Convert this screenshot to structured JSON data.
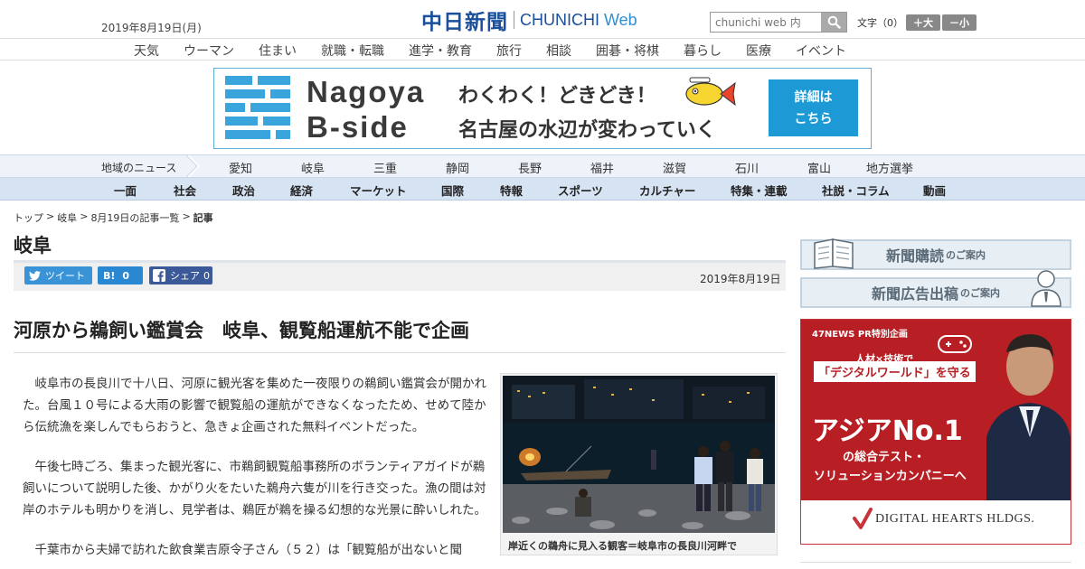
{
  "header": {
    "date": "2019年8月19日(月)",
    "logo_kanji": "中日新聞",
    "logo_en": "CHUNICHI",
    "logo_web": "Web",
    "search_placeholder": "chunichi web 内",
    "fontsize_label": "文字（0）",
    "font_bigger": "＋大",
    "font_smaller": "－小"
  },
  "top_nav": [
    "天気",
    "ウーマン",
    "住まい",
    "就職・転職",
    "進学・教育",
    "旅行",
    "相談",
    "囲碁・将棋",
    "暮らし",
    "医療",
    "イベント"
  ],
  "banner": {
    "name_line1": "Nagoya",
    "name_line2": "B-side",
    "caption1": "わくわく！どきどき！",
    "caption2": "名古屋の水辺が変わっていく",
    "cta_line1": "詳細は",
    "cta_line2": "こちら"
  },
  "region_nav": {
    "label": "地域のニュース",
    "items": [
      "愛知",
      "岐阜",
      "三重",
      "静岡",
      "長野",
      "福井",
      "滋賀",
      "石川",
      "富山",
      "地方選挙"
    ]
  },
  "category_nav": [
    "一面",
    "社会",
    "政治",
    "経済",
    "マーケット",
    "国際",
    "特報",
    "スポーツ",
    "カルチャー",
    "特集・連載",
    "社説・コラム",
    "動画"
  ],
  "breadcrumb": [
    "トップ",
    "岐阜",
    "8月19日の記事一覧",
    "記事"
  ],
  "section_title": "岐阜",
  "share": {
    "tweet": "ツイート",
    "hatena": "B!",
    "hatena_count": "0",
    "facebook": "シェア",
    "facebook_count": "0",
    "date": "2019年8月19日"
  },
  "article": {
    "headline": "河原から鵜飼い鑑賞会　岐阜、観覧船運航不能で企画",
    "paragraphs": [
      "岐阜市の長良川で十八日、河原に観光客を集めた一夜限りの鵜飼い鑑賞会が開かれた。台風１０号による大雨の影響で観覧船の運航ができなくなったため、せめて陸から伝統漁を楽しんでもらおうと、急きょ企画された無料イベントだった。",
      "午後七時ごろ、集まった観光客に、市鵜飼観覧船事務所のボランティアガイドが鵜飼いについて説明した後、かがり火をたいた鵜舟六隻が川を行き交った。漁の間は対岸のホテルも明かりを消し、見学者は、鵜匠が鵜を操る幻想的な光景に酔いしれた。",
      "千葉市から夫婦で訪れた飲食業吉原令子さん（５２）は「観覧船が出ないと聞"
    ],
    "photo_caption": "岸近くの鵜舟に見入る観客＝岐阜市の長良川河畔で"
  },
  "sidebar": {
    "subscribe_main": "新聞購読",
    "subscribe_sub": "のご案内",
    "adpost_main": "新聞広告出稿",
    "adpost_sub": "のご案内",
    "ad": {
      "news": "47NEWS PR特別企画",
      "line1": "人材×技術で",
      "line2": "「デジタルワールド」を守る",
      "line3": "アジアNo.1",
      "line4": "の総合テスト・",
      "line5": "ソリューションカンパニーへ",
      "brand": "DIGITAL HEARTS HLDGS."
    }
  },
  "colors": {
    "brand_blue": "#1a4f9c",
    "banner_blue": "#1d9ad6",
    "ad_red": "#b81f24"
  }
}
